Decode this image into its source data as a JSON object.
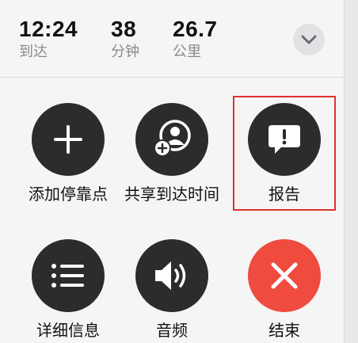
{
  "stats": {
    "arrival": {
      "value": "12:24",
      "unit": "到达"
    },
    "minutes": {
      "value": "38",
      "unit": "分钟"
    },
    "distance": {
      "value": "26.7",
      "unit": "公里"
    }
  },
  "actions": {
    "add_stop": {
      "label": "添加停靠点",
      "icon": "plus-icon"
    },
    "share_eta": {
      "label": "共享到达时间",
      "icon": "add-person-icon"
    },
    "report": {
      "label": "报告",
      "icon": "exclamation-bubble-icon"
    },
    "details": {
      "label": "详细信息",
      "icon": "list-icon"
    },
    "audio": {
      "label": "音频",
      "icon": "speaker-icon"
    },
    "end": {
      "label": "结束",
      "icon": "close-icon"
    }
  },
  "colors": {
    "button_dark": "#2c2c2e",
    "button_end": "#ef4b3f",
    "highlight": "#e0302f"
  }
}
